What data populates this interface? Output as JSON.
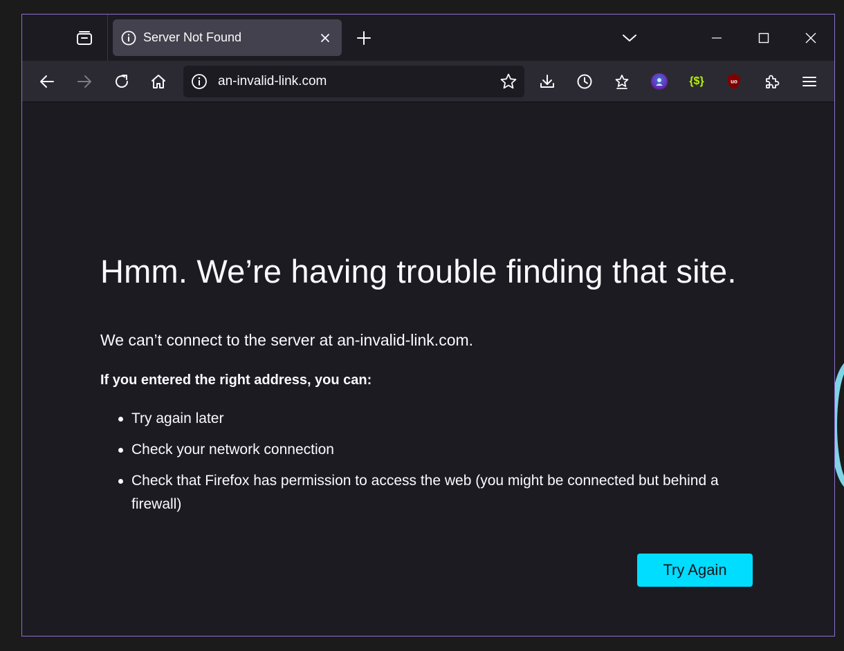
{
  "tab": {
    "title": "Server Not Found"
  },
  "urlbar": {
    "url": "an-invalid-link.com"
  },
  "extensions": {
    "ext2_label": "{$}",
    "ublock_label": "uo"
  },
  "error": {
    "title": "Hmm. We’re having trouble finding that site.",
    "description": "We can’t connect to the server at an-invalid-link.com.",
    "suggest_heading": "If you entered the right address, you can:",
    "suggestions": [
      "Try again later",
      "Check your network connection",
      "Check that Firefox has permission to access the web (you might be connected but behind a firewall)"
    ],
    "try_again_label": "Try Again"
  },
  "colors": {
    "accent": "#00ddff",
    "window_border": "#8f6fd0",
    "content_bg": "#1c1b22",
    "toolbar_bg": "#2b2a33"
  },
  "icons": {
    "tab_manager": "tab-manager-icon",
    "tab_info": "info-icon",
    "tab_close": "close-icon",
    "new_tab": "plus-icon",
    "tab_list": "chevron-down-icon",
    "back": "arrow-left-icon",
    "forward": "arrow-right-icon",
    "reload": "reload-icon",
    "home": "home-icon",
    "bookmark": "star-icon",
    "downloads": "download-icon",
    "history": "clock-icon",
    "bookmarks": "bookmark-star-icon",
    "extensions": "puzzle-icon",
    "menu": "hamburger-icon"
  }
}
